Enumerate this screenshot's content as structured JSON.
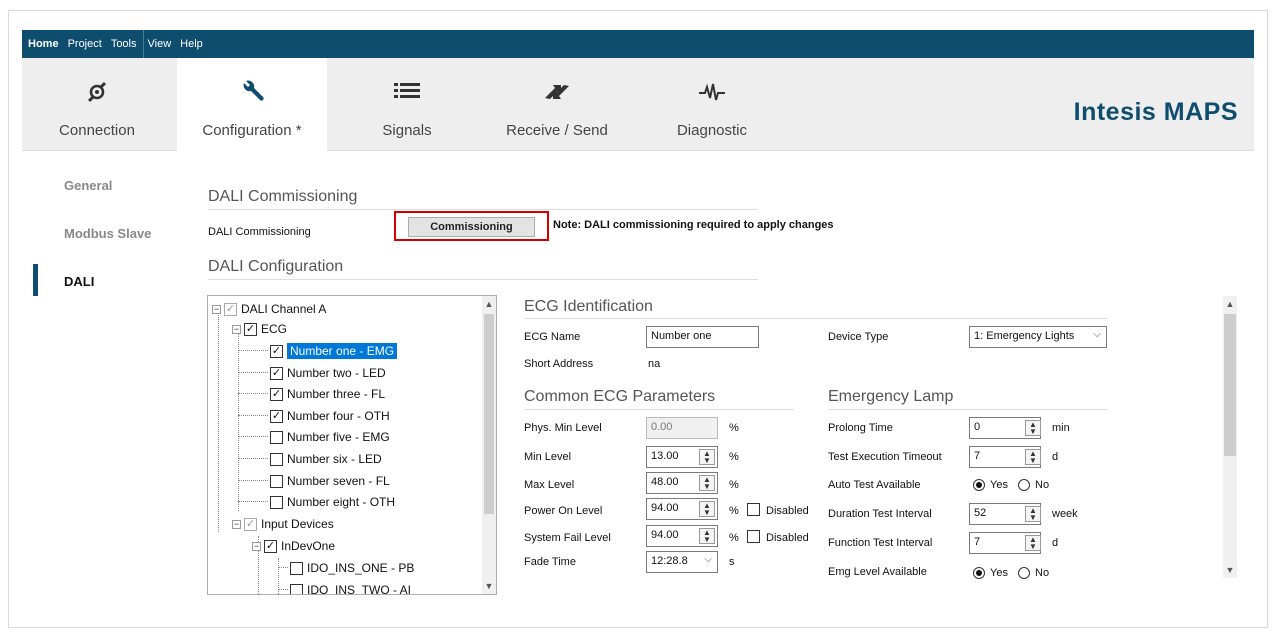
{
  "menu": {
    "items": [
      "Home",
      "Project",
      "Tools",
      "View",
      "Help"
    ]
  },
  "ribbon": {
    "tabs": [
      {
        "label": "Connection",
        "icon": "plug-icon"
      },
      {
        "label": "Configuration *",
        "icon": "wrench-icon"
      },
      {
        "label": "Signals",
        "icon": "list-icon"
      },
      {
        "label": "Receive / Send",
        "icon": "transfer-icon"
      },
      {
        "label": "Diagnostic",
        "icon": "waveform-icon"
      }
    ],
    "brand": "Intesis MAPS"
  },
  "sidebar": {
    "items": [
      {
        "label": "General"
      },
      {
        "label": "Modbus Slave"
      },
      {
        "label": "DALI"
      }
    ]
  },
  "commissioning": {
    "heading": "DALI Commissioning",
    "row_label": "DALI Commissioning",
    "button_label": "Commissioning",
    "note": "Note: DALI commissioning required to apply changes"
  },
  "configuration": {
    "heading": "DALI Configuration"
  },
  "tree": {
    "channel": "DALI Channel A",
    "ecg_group": "ECG",
    "ecg_items": [
      {
        "label": "Number one - EMG",
        "checked": true,
        "selected": true
      },
      {
        "label": "Number two - LED",
        "checked": true
      },
      {
        "label": "Number three - FL",
        "checked": true
      },
      {
        "label": "Number four - OTH",
        "checked": true
      },
      {
        "label": "Number five - EMG",
        "checked": false
      },
      {
        "label": "Number six - LED",
        "checked": false
      },
      {
        "label": "Number seven - FL",
        "checked": false
      },
      {
        "label": "Number eight - OTH",
        "checked": false
      }
    ],
    "input_group": "Input Devices",
    "input_device": "InDevOne",
    "input_items": [
      {
        "label": "IDO_INS_ONE - PB"
      },
      {
        "label": "IDO_INS_TWO - AI"
      }
    ]
  },
  "ecg_identification": {
    "heading": "ECG Identification",
    "name_label": "ECG Name",
    "name_value": "Number one",
    "short_address_label": "Short Address",
    "short_address_value": "na",
    "device_type_label": "Device Type",
    "device_type_value": "1: Emergency Lights"
  },
  "common_params": {
    "heading": "Common ECG Parameters",
    "phys_min_label": "Phys. Min Level",
    "phys_min_value": "0.00",
    "min_label": "Min Level",
    "min_value": "13.00",
    "max_label": "Max Level",
    "max_value": "48.00",
    "power_on_label": "Power On Level",
    "power_on_value": "94.00",
    "system_fail_label": "System Fail Level",
    "system_fail_value": "94.00",
    "fade_label": "Fade Time",
    "fade_value": "12:28.8",
    "percent": "%",
    "seconds": "s",
    "disabled_label": "Disabled"
  },
  "emergency": {
    "heading": "Emergency Lamp",
    "prolong_label": "Prolong Time",
    "prolong_value": "0",
    "prolong_unit": "min",
    "test_exec_label": "Test Execution Timeout",
    "test_exec_value": "7",
    "test_exec_unit": "d",
    "auto_test_label": "Auto Test Available",
    "yes": "Yes",
    "no": "No",
    "duration_label": "Duration Test Interval",
    "duration_value": "52",
    "duration_unit": "week",
    "function_label": "Function Test Interval",
    "function_value": "7",
    "function_unit": "d",
    "emg_level_label": "Emg Level Available"
  },
  "colors": {
    "menubar": "#0f4d6e",
    "ribbon": "#eeeeee",
    "highlight": "#d40000",
    "selection": "#0078d7"
  }
}
